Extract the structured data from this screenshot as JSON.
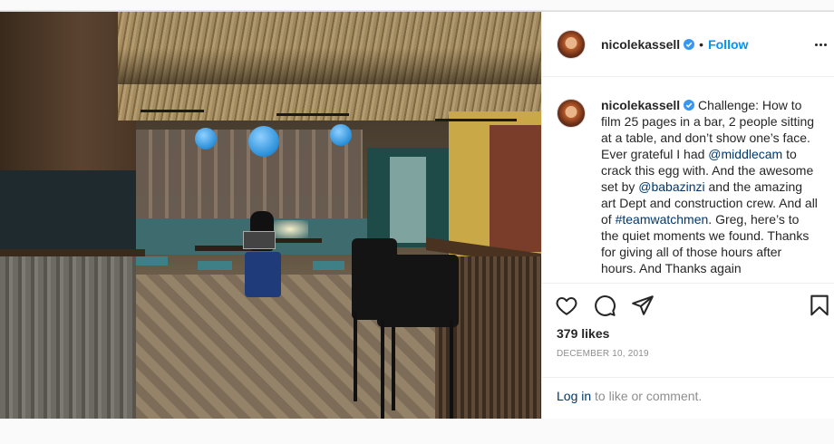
{
  "post": {
    "username": "nicolekassell",
    "verified": true,
    "follow_label": "Follow",
    "separator": "•",
    "caption": {
      "username": "nicolekassell",
      "text_1": " Challenge: How to film 25 pages in a bar, 2 people sitting at a table, and don’t show one’s face. Ever grateful I had ",
      "mention_1": "@middlecam",
      "text_2": " to crack this egg with. And the awesome set by ",
      "mention_2": "@babazinzi",
      "text_3": " and the amazing art Dept and construction crew. And all of ",
      "hashtag_1": "#teamwatchmen",
      "text_4": ". Greg, here’s to the quiet moments we found. Thanks for giving all of those hours after hours. And Thanks again"
    },
    "likes": "379 likes",
    "date": "DECEMBER 10, 2019",
    "login_link": "Log in",
    "login_rest": " to like or comment."
  },
  "icons": {
    "like": "heart-icon",
    "comment": "comment-bubble-icon",
    "share": "paper-plane-icon",
    "save": "bookmark-icon",
    "more": "more-options-icon",
    "verified": "verified-badge-icon"
  },
  "colors": {
    "accent": "#0095f6",
    "link": "#00376b",
    "muted": "#8e8e8e",
    "text": "#262626"
  }
}
